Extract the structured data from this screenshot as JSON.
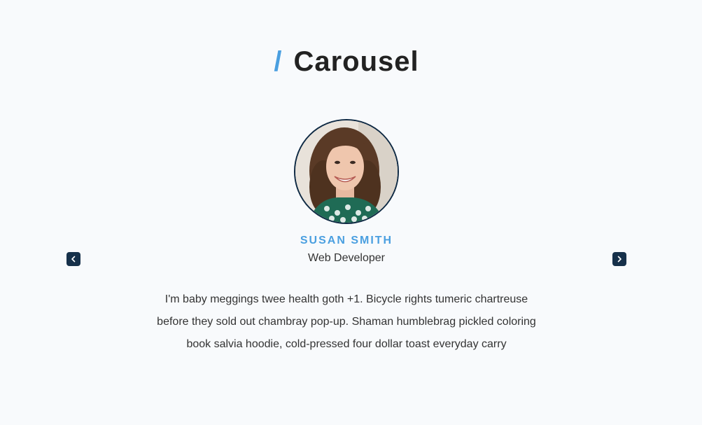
{
  "header": {
    "slash": "/",
    "title": "Carousel"
  },
  "review": {
    "avatar_alt": "Susan Smith",
    "name": "SUSAN SMITH",
    "job": "Web Developer",
    "text": "I'm baby meggings twee health goth +1. Bicycle rights tumeric chartreuse before they sold out chambray pop-up. Shaman humblebrag pickled coloring book salvia hoodie, cold-pressed four dollar toast everyday carry"
  },
  "controls": {
    "prev_icon": "chevron-left-icon",
    "next_icon": "chevron-right-icon"
  },
  "colors": {
    "accent": "#4a9fe0",
    "button_bg": "#16304a",
    "page_bg": "#f8fafc"
  }
}
